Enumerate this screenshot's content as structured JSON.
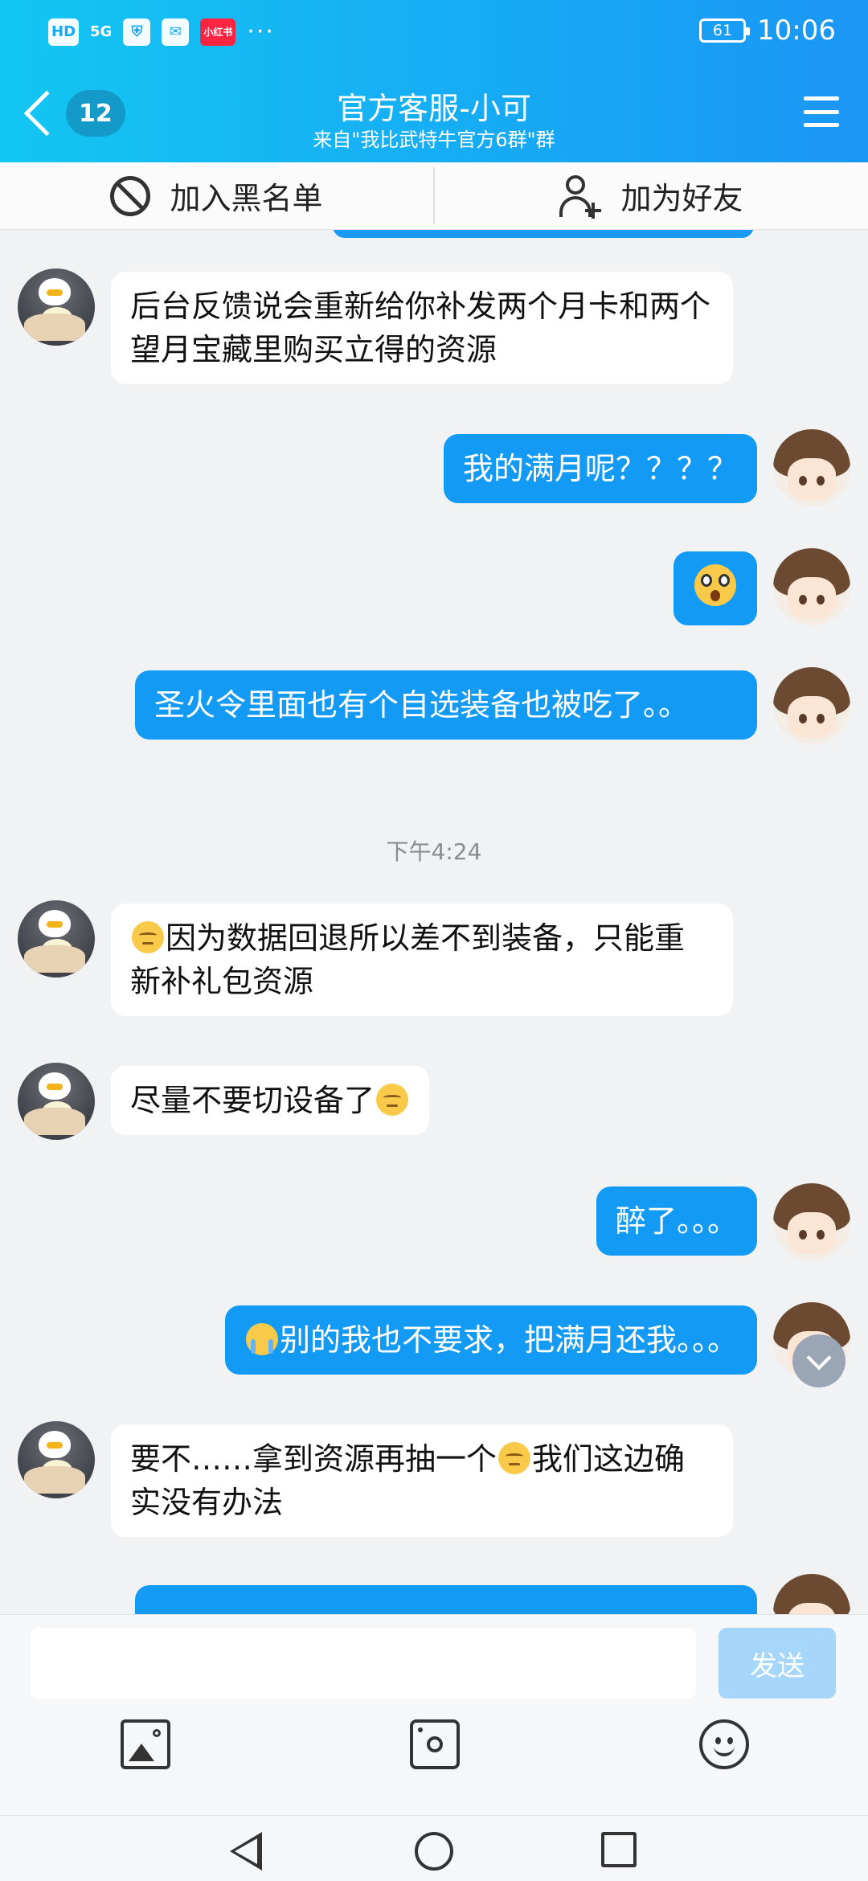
{
  "status_bar": {
    "network": "HD",
    "network_type": "5G",
    "more": "···",
    "battery": "61",
    "time": "10:06",
    "app_badge": "小红书"
  },
  "header": {
    "unread_count": "12",
    "title": "官方客服-小可",
    "subtitle": "来自\"我比武特牛官方6群\"群"
  },
  "actions": {
    "blacklist": "加入黑名单",
    "add_friend": "加为好友"
  },
  "messages": [
    {
      "from": "service",
      "text": "后台反馈说会重新给你补发两个月卡和两个望月宝藏里购买立得的资源"
    },
    {
      "from": "me",
      "text": "我的满月呢？？？？"
    },
    {
      "from": "me",
      "emoji": "shocked-emoji"
    },
    {
      "from": "me",
      "text": "圣火令里面也有个自选装备也被吃了。。"
    },
    {
      "from": "service",
      "emoji": "sad-emoji",
      "text": "因为数据回退所以差不到装备，只能重新补礼包资源"
    },
    {
      "from": "service",
      "text": "尽量不要切设备了",
      "emoji": "sad-emoji"
    },
    {
      "from": "me",
      "text": "醉了。。。"
    },
    {
      "from": "me",
      "emoji": "crying-emoji",
      "text": "别的我也不要求，把满月还我。。。"
    },
    {
      "from": "service",
      "text_a": "要不……拿到资源再抽一个",
      "emoji": "sad-emoji",
      "text_b": "我们这边确实没有办法"
    }
  ],
  "timestamp": "下午4:24",
  "input": {
    "value": "",
    "send_label": "发送"
  },
  "colors": {
    "header": "#17a9f4",
    "outgoing_bubble": "#139af5",
    "incoming_bubble": "#ffffff",
    "send_disabled": "#a6d7fa"
  }
}
